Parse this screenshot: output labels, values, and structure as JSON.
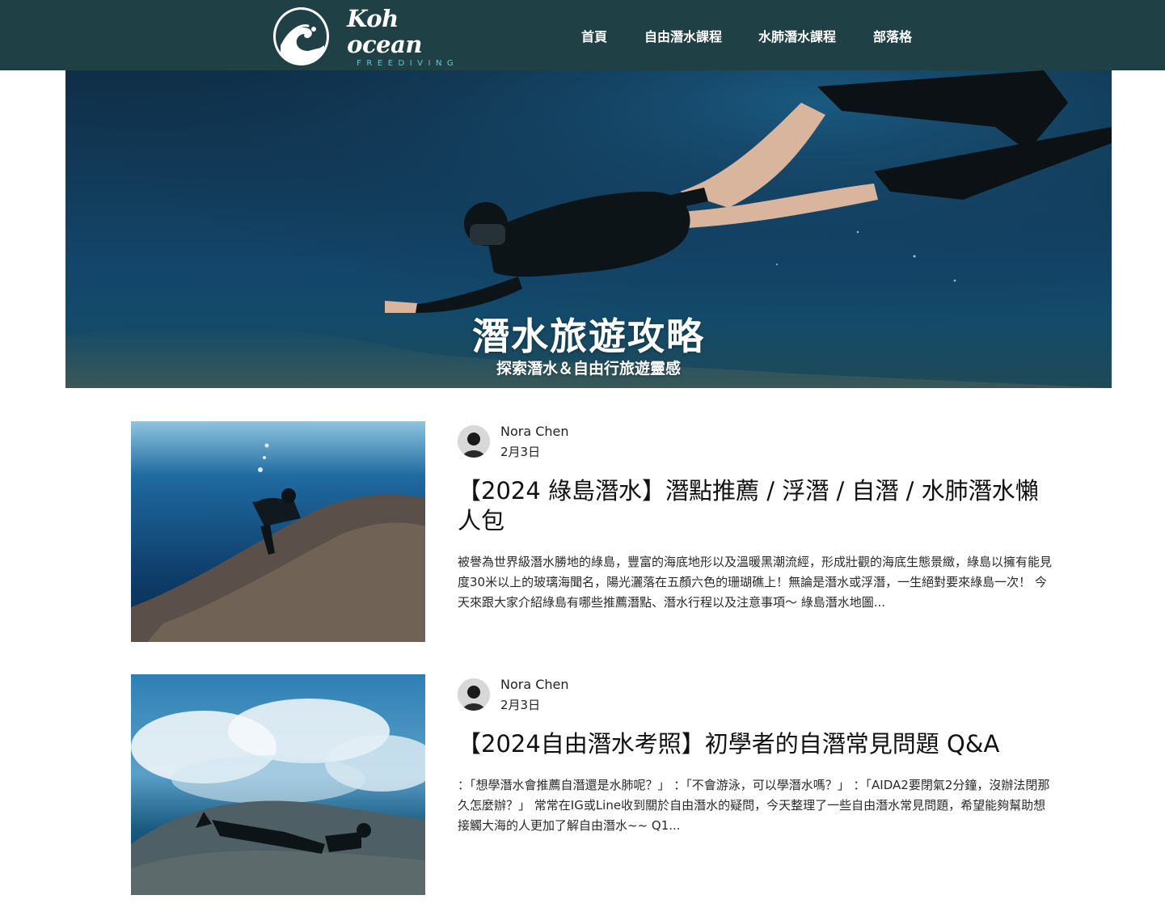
{
  "header": {
    "logo_name": "Koh ocean",
    "logo_sub": "FREEDIVING",
    "nav": [
      "首頁",
      "自由潛水課程",
      "水肺潛水課程",
      "部落格"
    ]
  },
  "hero": {
    "title": "潛水旅遊攻略",
    "subtitle": "探索潛水＆自由行旅遊靈感"
  },
  "posts": [
    {
      "author": "Nora Chen",
      "date": "2月3日",
      "title": "【2024 綠島潛水】潛點推薦 / 浮潛 / 自潛 / 水肺潛水懶人包",
      "excerpt": "被譽為世界級潛水勝地的綠島，豐富的海底地形以及溫暖黑潮流經，形成壯觀的海底生態景緻，綠島以擁有能見度30米以上的玻璃海聞名，陽光灑落在五顏六色的珊瑚礁上！無論是潛水或浮潛，一生絕對要來綠島一次！ 今天來跟大家介紹綠島有哪些推薦潛點、潛水行程以及注意事項～ 綠島潛水地圖..."
    },
    {
      "author": "Nora Chen",
      "date": "2月3日",
      "title": "【2024自由潛水考照】初學者的自潛常見問題 Q&A",
      "excerpt": "：「想學潛水會推薦自潛還是水肺呢？」 ：「不會游泳，可以學潛水嗎？」 ：「AIDA2要閉氣2分鐘，沒辦法閉那久怎麼辦？」 常常在IG或Line收到關於自由潛水的疑問，今天整理了一些自由潛水常見問題，希望能夠幫助想接觸大海的人更加了解自由潛水~~ Q1..."
    }
  ]
}
